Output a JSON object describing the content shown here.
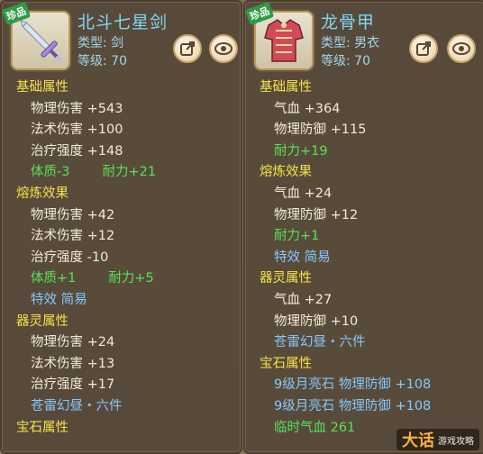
{
  "colors": {
    "section": "#f4e24a",
    "white": "#f2ebd9",
    "green": "#58e15a",
    "blue": "#86c8ff",
    "name": "#7fd6f4"
  },
  "left": {
    "badge": "珍品",
    "name": "北斗七星剑",
    "type": "类型: 剑",
    "level": "等级: 70",
    "sections": {
      "basic": "基础属性",
      "refine": "熔炼效果",
      "spirit": "器灵属性",
      "gem": "宝石属性"
    },
    "rows": {
      "b1": "物理伤害 +543",
      "b2": "法术伤害 +100",
      "b3": "治疗强度 +148",
      "b4a": "体质-3",
      "b4b": "耐力+21",
      "r1": "物理伤害 +42",
      "r2": "法术伤害 +12",
      "r3": "治疗强度 -10",
      "r4a": "体质+1",
      "r4b": "耐力+5",
      "r5": "特效 简易",
      "s1": "物理伤害 +24",
      "s2": "法术伤害 +13",
      "s3": "治疗强度 +17",
      "s4": "苍雷幻昼・六件"
    }
  },
  "right": {
    "badge": "珍品",
    "name": "龙骨甲",
    "type": "类型: 男衣",
    "level": "等级: 70",
    "sections": {
      "basic": "基础属性",
      "refine": "熔炼效果",
      "spirit": "器灵属性",
      "gem": "宝石属性"
    },
    "rows": {
      "b1": "气血 +364",
      "b2": "物理防御 +115",
      "b3": "耐力+19",
      "r1": "气血 +24",
      "r2": "物理防御 +12",
      "r3": "耐力+1",
      "r4": "特效 简易",
      "s1": "气血 +27",
      "s2": "物理防御 +10",
      "s3": "苍雷幻昼・六件",
      "g1": "9级月亮石 物理防御 +108",
      "g2": "9级月亮石 物理防御 +108",
      "g3": "临时气血 261"
    }
  },
  "watermark": {
    "big": "大话",
    "small": "游戏攻略"
  }
}
